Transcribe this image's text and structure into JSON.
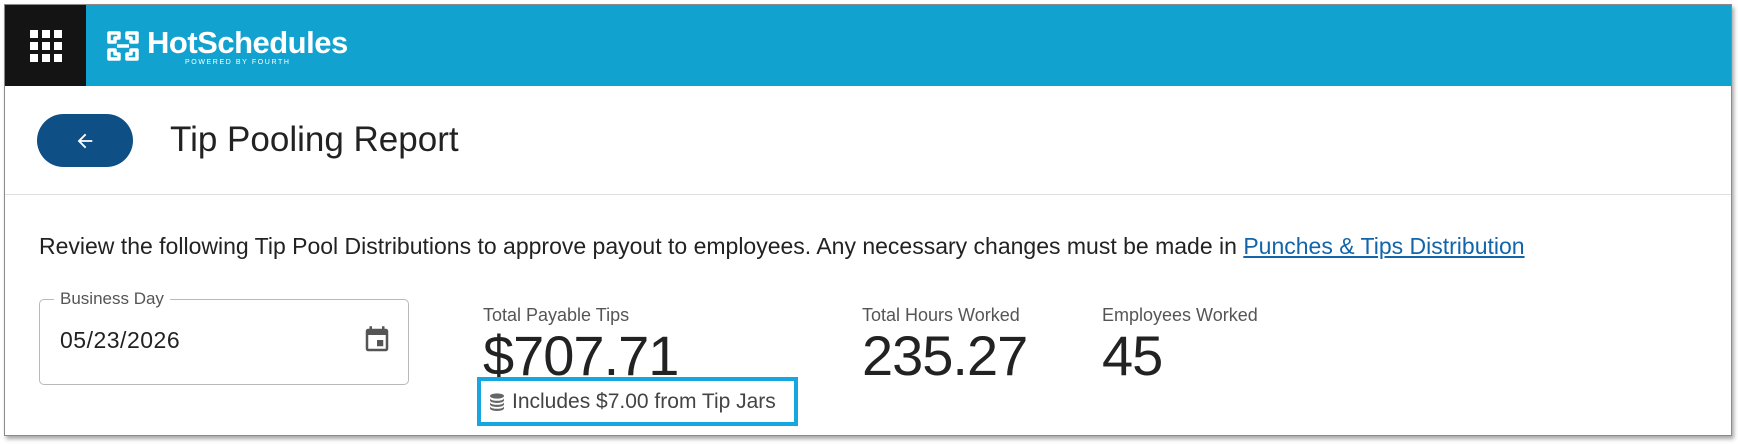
{
  "brand": {
    "name": "HotSchedules",
    "tagline": "POWERED BY FOURTH",
    "bar_color": "#12a2cf",
    "button_color": "#0e4f85",
    "highlight_color": "#16a7e0"
  },
  "header": {
    "title": "Tip Pooling Report",
    "back_icon": "arrow-left-icon"
  },
  "intro": {
    "text": "Review the following Tip Pool Distributions to approve payout to employees. Any necessary changes must be made in ",
    "link_label": "Punches & Tips Distribution"
  },
  "business_day": {
    "label": "Business Day",
    "value": "05/23/2026",
    "icon": "calendar-icon"
  },
  "stats": {
    "tips": {
      "label": "Total Payable Tips",
      "value": "$707.71"
    },
    "hours": {
      "label": "Total Hours Worked",
      "value": "235.27"
    },
    "employees": {
      "label": "Employees Worked",
      "value": "45"
    }
  },
  "tip_jar_note": {
    "text": "Includes $7.00 from Tip Jars",
    "icon": "coins-icon"
  }
}
